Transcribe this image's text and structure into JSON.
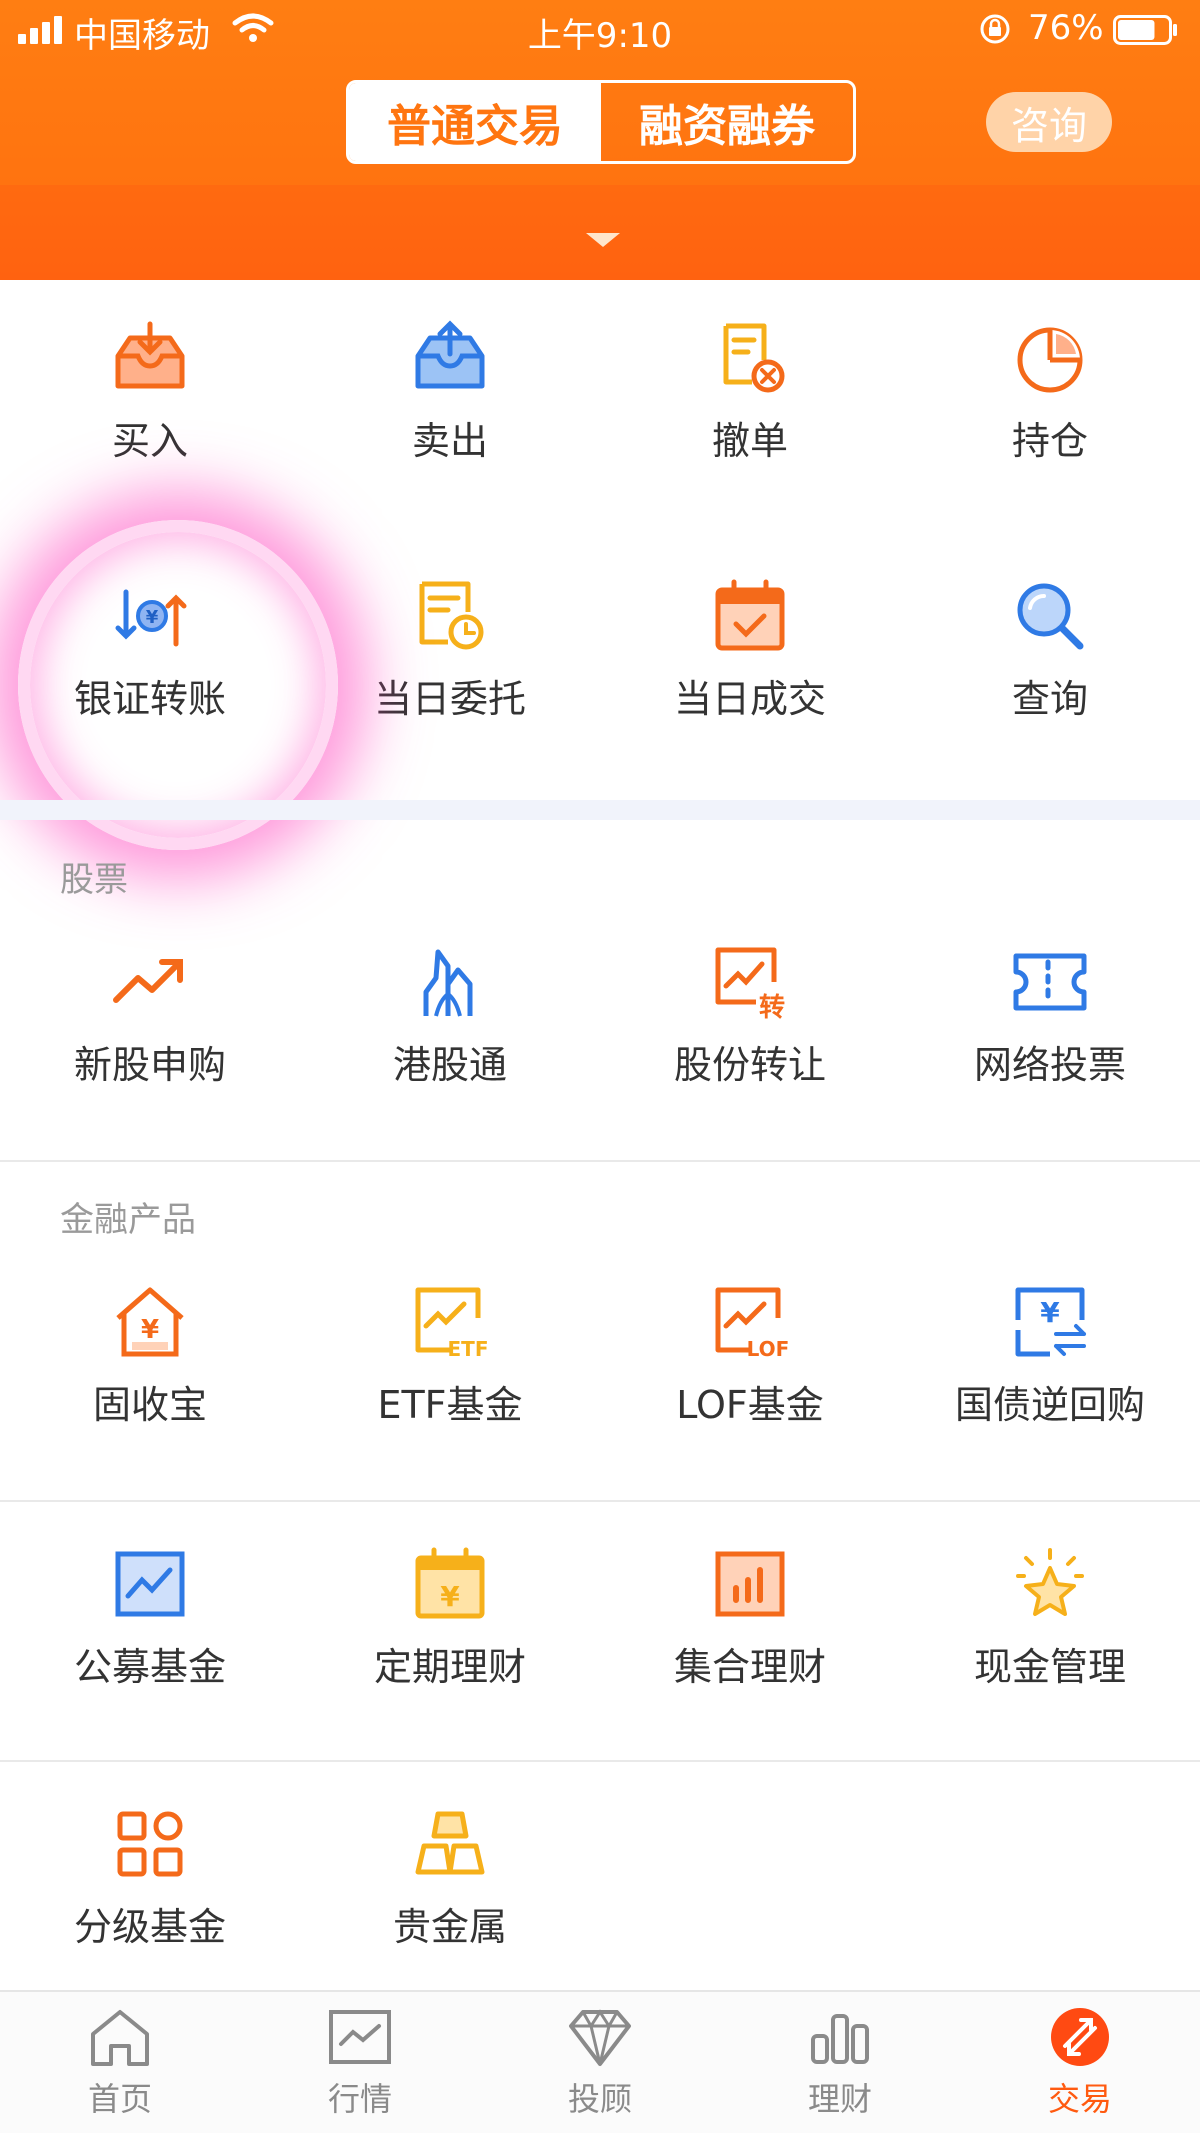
{
  "status_bar": {
    "carrier": "中国移动",
    "time": "上午9:10",
    "battery_percent": "76%",
    "battery_level": 0.76
  },
  "header": {
    "tabs": [
      {
        "label": "普通交易",
        "selected": true
      },
      {
        "label": "融资融券",
        "selected": false
      }
    ],
    "consult_label": "咨询"
  },
  "top_grid": {
    "items": [
      {
        "label": "买入",
        "icon": "buy-icon"
      },
      {
        "label": "卖出",
        "icon": "sell-icon"
      },
      {
        "label": "撤单",
        "icon": "cancel-order-icon"
      },
      {
        "label": "持仓",
        "icon": "position-pie-icon"
      },
      {
        "label": "银证转账",
        "icon": "bank-transfer-icon"
      },
      {
        "label": "当日委托",
        "icon": "today-orders-icon"
      },
      {
        "label": "当日成交",
        "icon": "today-deals-icon"
      },
      {
        "label": "查询",
        "icon": "search-icon"
      }
    ]
  },
  "stocks_section": {
    "title": "股票",
    "items": [
      {
        "label": "新股申购",
        "icon": "ipo-trend-icon"
      },
      {
        "label": "港股通",
        "icon": "hk-connect-icon"
      },
      {
        "label": "股份转让",
        "icon": "share-transfer-icon"
      },
      {
        "label": "网络投票",
        "icon": "vote-ticket-icon"
      }
    ]
  },
  "finance_section": {
    "title": "金融产品",
    "items": [
      {
        "label": "固收宝",
        "icon": "fixed-income-icon"
      },
      {
        "label": "ETF基金",
        "icon": "etf-fund-icon"
      },
      {
        "label": "LOF基金",
        "icon": "lof-fund-icon"
      },
      {
        "label": "国债逆回购",
        "icon": "reverse-repo-icon"
      },
      {
        "label": "公募基金",
        "icon": "public-fund-icon"
      },
      {
        "label": "定期理财",
        "icon": "term-finance-icon"
      },
      {
        "label": "集合理财",
        "icon": "collective-finance-icon"
      },
      {
        "label": "现金管理",
        "icon": "cash-management-icon"
      },
      {
        "label": "分级基金",
        "icon": "graded-fund-icon"
      },
      {
        "label": "贵金属",
        "icon": "precious-metal-icon"
      }
    ]
  },
  "bottom_nav": {
    "items": [
      {
        "label": "首页",
        "icon": "home-icon",
        "active": false
      },
      {
        "label": "行情",
        "icon": "market-icon",
        "active": false
      },
      {
        "label": "投顾",
        "icon": "advisor-diamond-icon",
        "active": false
      },
      {
        "label": "理财",
        "icon": "finance-bars-icon",
        "active": false
      },
      {
        "label": "交易",
        "icon": "trade-icon",
        "active": true
      }
    ]
  },
  "colors": {
    "brand_orange": "#ff7510",
    "icon_orange": "#f46a1a",
    "icon_blue": "#2f7ae5",
    "icon_yellow": "#f6b01a",
    "highlight_pink": "#ff4bbf"
  }
}
